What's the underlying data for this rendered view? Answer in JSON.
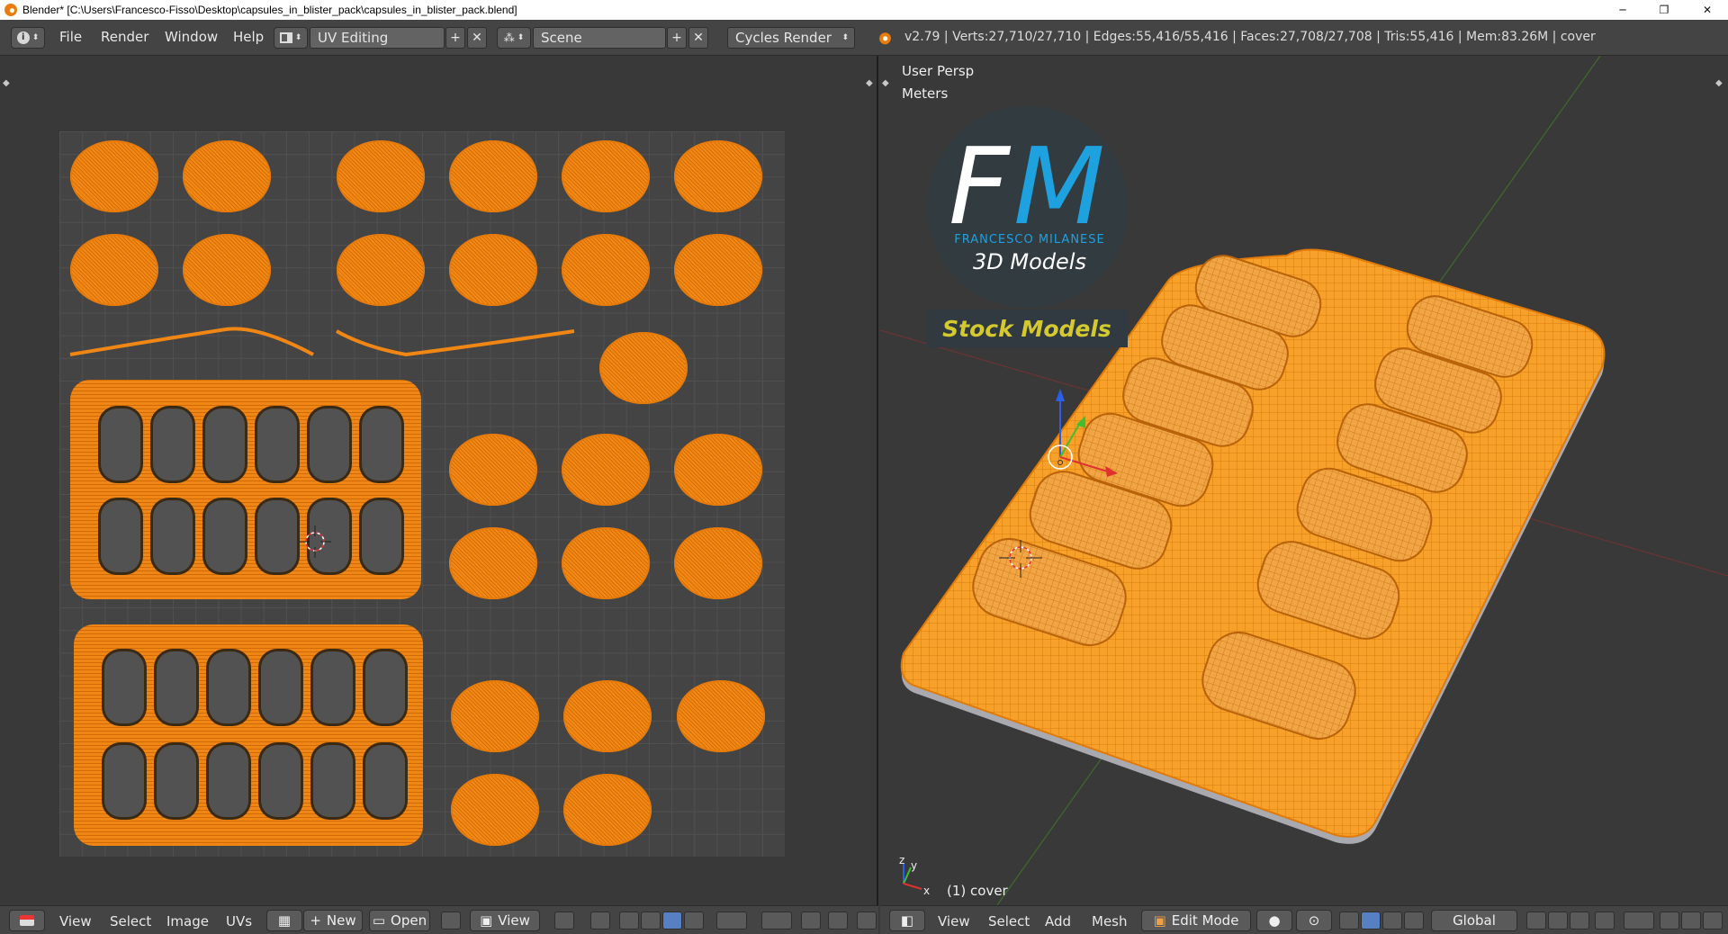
{
  "window": {
    "title": "Blender* [C:\\Users\\Francesco-Fisso\\Desktop\\capsules_in_blister_pack\\capsules_in_blister_pack.blend]",
    "minimize": "─",
    "maximize": "❐",
    "close": "✕"
  },
  "header": {
    "menus": [
      "File",
      "Render",
      "Window",
      "Help"
    ],
    "screen_layout": "UV Editing",
    "scene": "Scene",
    "render_engine": "Cycles Render",
    "stats": "v2.79 | Verts:27,710/27,710 | Edges:55,416/55,416 | Faces:27,708/27,708 | Tris:55,416 | Mem:83.26M | cover"
  },
  "viewport": {
    "view_name": "User Persp",
    "units": "Meters",
    "object_label": "(1) cover",
    "axis_labels": [
      "z",
      "y",
      "x"
    ]
  },
  "logo": {
    "letter_f": "F",
    "letter_m": "M",
    "name": "FRANCESCO MILANESE",
    "tagline": "3D Models",
    "stock": "Stock Models"
  },
  "uv_footer": {
    "menus": [
      "View",
      "Select",
      "Image",
      "UVs"
    ],
    "new_label": "New",
    "open_label": "Open",
    "view_label": "View"
  },
  "view3d_footer": {
    "menus": [
      "View",
      "Select",
      "Add",
      "Mesh"
    ],
    "mode": "Edit Mode",
    "orientation": "Global"
  },
  "colors": {
    "accent_orange": "#f08715",
    "logo_blue": "#1ea1df",
    "stock_yellow": "#d4c92f"
  }
}
